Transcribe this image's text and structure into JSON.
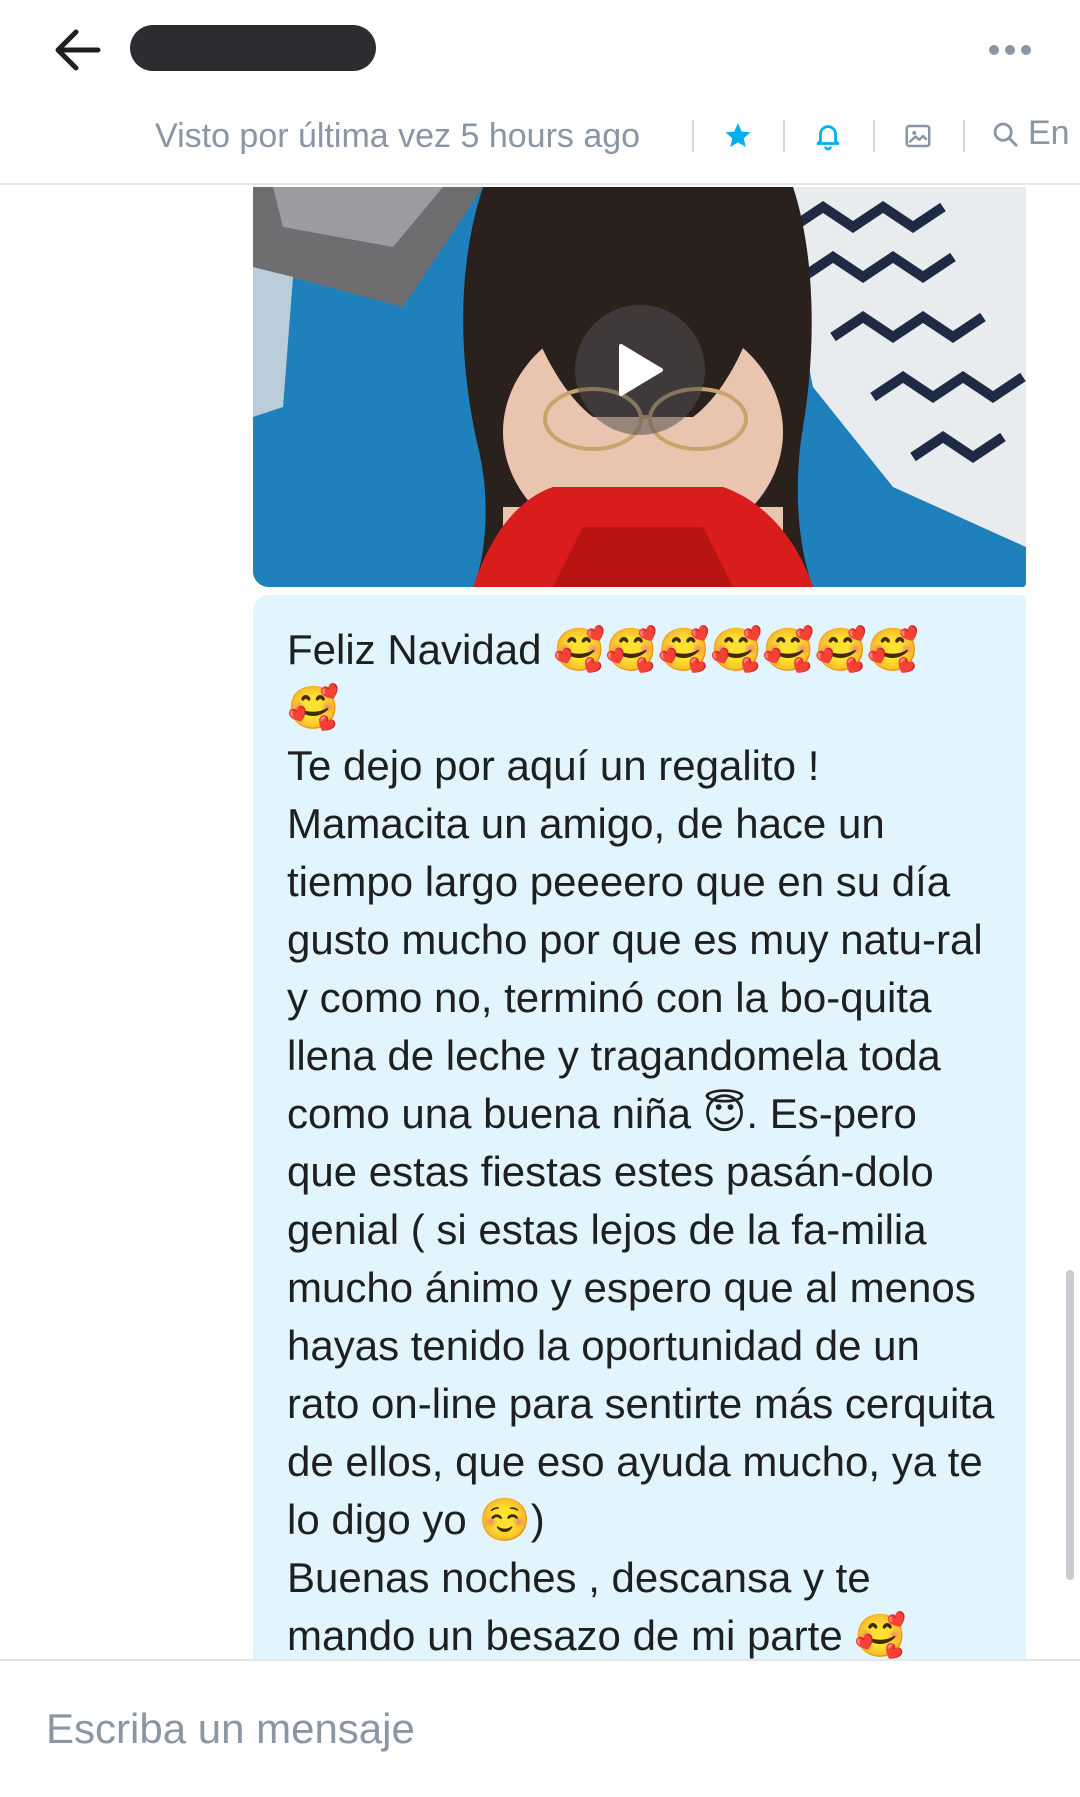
{
  "header": {
    "back_icon": "arrow-left-icon",
    "more_icon": "more-horizontal-icon",
    "last_seen": "Visto por última vez 5 hours ago",
    "search_label": "En",
    "icons": [
      "star-icon",
      "bell-icon",
      "image-icon",
      "search-icon"
    ],
    "colors": {
      "accent": "#00aff0",
      "muted": "#8a96a3"
    }
  },
  "chat": {
    "video": {
      "play_icon": "play-icon"
    },
    "message": {
      "text": "Feliz Navidad 🥰🥰🥰🥰🥰🥰🥰\n🥰\nTe dejo por aquí un regalito !\nMamacita un amigo, de hace un tiempo largo peeeero que en su día gusto mucho por que es muy natu-ral y como no, terminó con la bo-quita llena de leche y tragandomela toda como una buena niña 😇. Es-pero que estas fiestas estes pasán-dolo genial ( si estas lejos de la fa-milia mucho ánimo y espero que al menos hayas tenido la oportunidad de un rato on-line para sentirte más cerquita de ellos, que eso ayuda mucho, ya te lo digo yo ☺️)\nBuenas noches , descansa y te mando un besazo de mi parte 🥰",
      "bubble_color": "#e2f4fd"
    }
  },
  "composer": {
    "placeholder": "Escriba un mensaje"
  }
}
